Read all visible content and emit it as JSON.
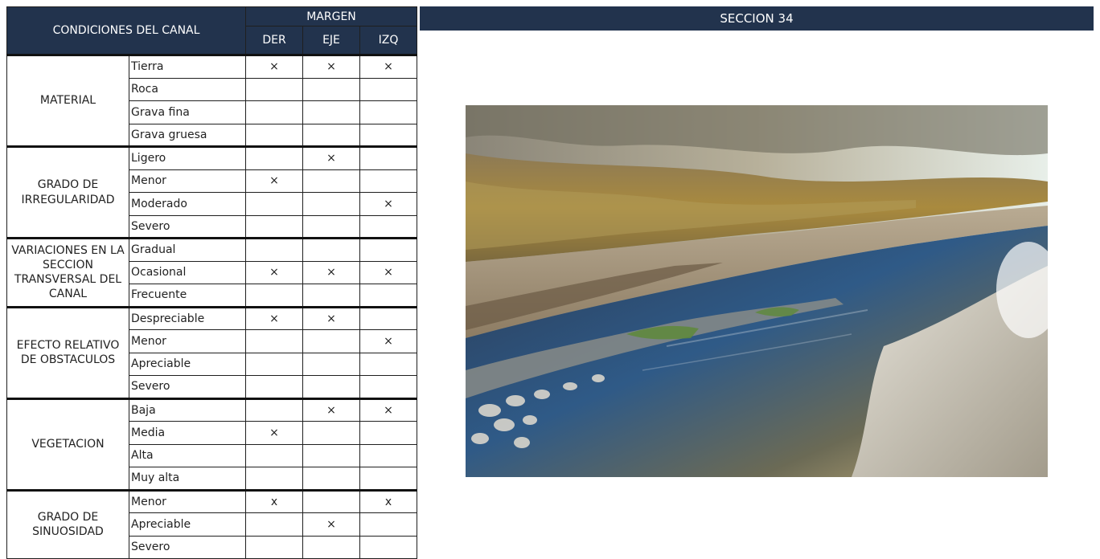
{
  "table": {
    "header_title": "CONDICIONES DEL CANAL",
    "margen_label": "MARGEN",
    "columns": [
      "DER",
      "EJE",
      "IZQ"
    ],
    "groups": [
      {
        "label": "MATERIAL",
        "rows": [
          {
            "option": "Tierra",
            "marks": [
              "×",
              "×",
              "×"
            ]
          },
          {
            "option": "Roca",
            "marks": [
              "",
              "",
              ""
            ]
          },
          {
            "option": "Grava fina",
            "marks": [
              "",
              "",
              ""
            ]
          },
          {
            "option": "Grava gruesa",
            "marks": [
              "",
              "",
              ""
            ]
          }
        ]
      },
      {
        "label": "GRADO DE IRREGULARIDAD",
        "rows": [
          {
            "option": "Ligero",
            "marks": [
              "",
              "×",
              ""
            ]
          },
          {
            "option": "Menor",
            "marks": [
              "×",
              "",
              ""
            ]
          },
          {
            "option": "Moderado",
            "marks": [
              "",
              "",
              "×"
            ]
          },
          {
            "option": "Severo",
            "marks": [
              "",
              "",
              ""
            ]
          }
        ]
      },
      {
        "label": "VARIACIONES EN LA SECCION TRANSVERSAL DEL CANAL",
        "rows": [
          {
            "option": "Gradual",
            "marks": [
              "",
              "",
              ""
            ]
          },
          {
            "option": "Ocasional",
            "marks": [
              "×",
              "×",
              "×"
            ]
          },
          {
            "option": "Frecuente",
            "marks": [
              "",
              "",
              ""
            ]
          }
        ]
      },
      {
        "label": "EFECTO RELATIVO DE OBSTACULOS",
        "rows": [
          {
            "option": "Despreciable",
            "marks": [
              "×",
              "×",
              ""
            ]
          },
          {
            "option": "Menor",
            "marks": [
              "",
              "",
              "×"
            ]
          },
          {
            "option": "Apreciable",
            "marks": [
              "",
              "",
              ""
            ]
          },
          {
            "option": "Severo",
            "marks": [
              "",
              "",
              ""
            ]
          }
        ]
      },
      {
        "label": "VEGETACION",
        "rows": [
          {
            "option": "Baja",
            "marks": [
              "",
              "×",
              "×"
            ]
          },
          {
            "option": "Media",
            "marks": [
              "×",
              "",
              ""
            ]
          },
          {
            "option": "Alta",
            "marks": [
              "",
              "",
              ""
            ]
          },
          {
            "option": "Muy alta",
            "marks": [
              "",
              "",
              ""
            ]
          }
        ]
      },
      {
        "label": "GRADO DE SINUOSIDAD",
        "rows": [
          {
            "option": "Menor",
            "marks": [
              "x",
              "",
              "x"
            ]
          },
          {
            "option": "Apreciable",
            "marks": [
              "",
              "×",
              ""
            ]
          },
          {
            "option": "Severo",
            "marks": [
              "",
              "",
              ""
            ]
          }
        ]
      }
    ]
  },
  "section": {
    "title": "SECCION 34"
  },
  "colors": {
    "header_bg": "#22334d",
    "header_text": "#ffffff"
  }
}
